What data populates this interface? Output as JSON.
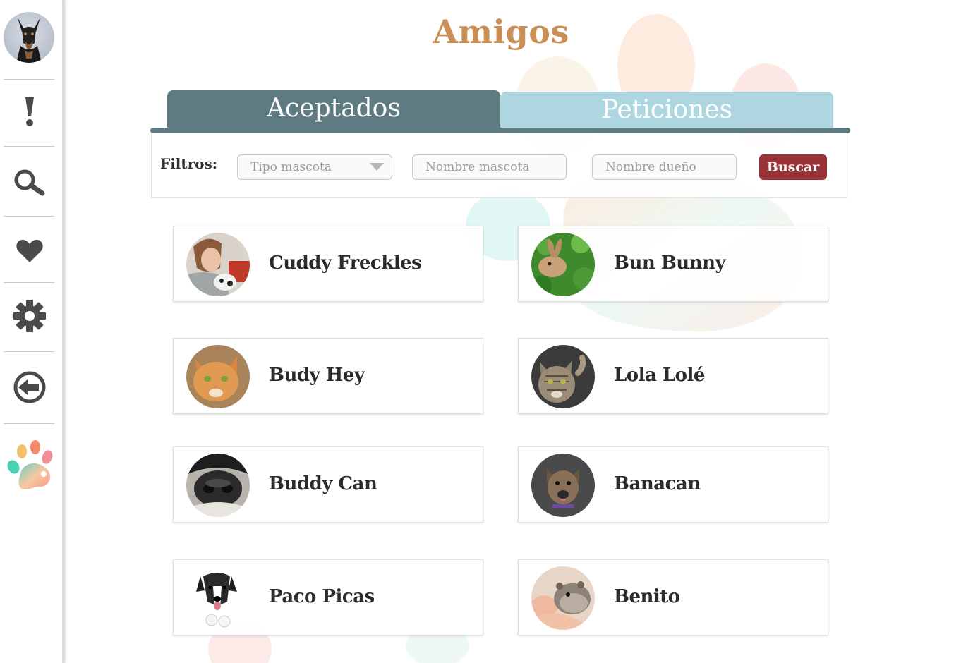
{
  "header": {
    "title": "Amigos"
  },
  "tabs": [
    {
      "label": "Aceptados",
      "active": true
    },
    {
      "label": "Peticiones",
      "active": false
    }
  ],
  "filters": {
    "label": "Filtros:",
    "pet_type_placeholder": "Tipo mascota",
    "pet_name_placeholder": "Nombre mascota",
    "owner_name_placeholder": "Nombre dueño",
    "search_label": "Buscar"
  },
  "sidebar": {
    "items": [
      {
        "icon": "profile-avatar"
      },
      {
        "icon": "exclamation-icon"
      },
      {
        "icon": "search-icon"
      },
      {
        "icon": "heart-icon"
      },
      {
        "icon": "gear-icon"
      },
      {
        "icon": "logout-icon"
      },
      {
        "icon": "paw-logo-icon"
      }
    ]
  },
  "friends": [
    {
      "name": "Cuddy Freckles"
    },
    {
      "name": "Bun Bunny"
    },
    {
      "name": "Budy Hey"
    },
    {
      "name": "Lola Lolé"
    },
    {
      "name": "Buddy Can"
    },
    {
      "name": "Banacan"
    },
    {
      "name": "Paco Picas"
    },
    {
      "name": "Benito"
    }
  ],
  "colors": {
    "title": "#c98f55",
    "tab_active": "#5e7b82",
    "tab_inactive": "#aed6e0",
    "search_button": "#993237",
    "icon": "#4a4a4a"
  }
}
